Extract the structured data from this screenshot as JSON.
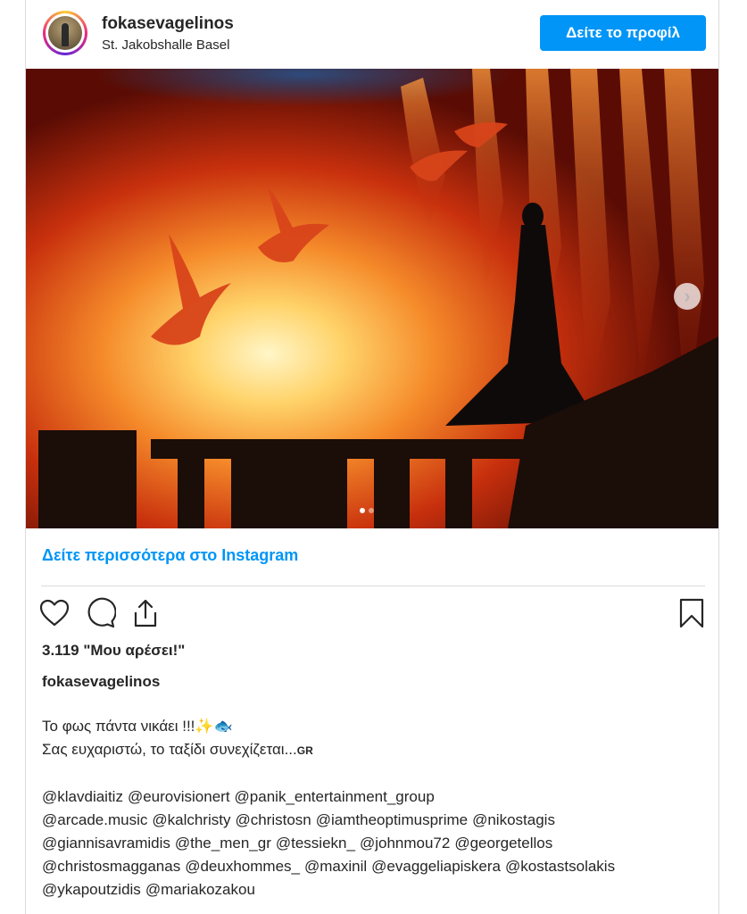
{
  "header": {
    "username": "fokasevagelinos",
    "location": "St. Jakobshalle Basel",
    "view_profile_label": "Δείτε το προφίλ"
  },
  "media": {
    "carousel_count": 2,
    "carousel_active": 1,
    "next_icon": "chevron-right-icon"
  },
  "more_link": "Δείτε περισσότερα στο Instagram",
  "actions": {
    "like_icon": "heart-icon",
    "comment_icon": "comment-icon",
    "share_icon": "share-icon",
    "save_icon": "bookmark-icon"
  },
  "likes_text": "3.119 \"Μου αρέσει!\"",
  "caption": {
    "username": "fokasevagelinos",
    "line1": "Το φως πάντα νικάει !!!",
    "line1_emoji": "✨🐟",
    "line2": "Σας ευχαριστώ, το ταξίδι συνεχίζεται...",
    "line2_suffix": "GR"
  },
  "tags": [
    "@klavdiaitiz",
    "@eurovisionert",
    "@panik_entertainment_group",
    "@arcade.music",
    "@kalchristy",
    "@christosn",
    "@iamtheoptimusprime",
    "@nikostagis",
    "@giannisavramidis",
    "@the_men_gr",
    "@tessiekn_",
    "@johnmou72",
    "@georgetellos",
    "@christosmagganas",
    "@deuxhommes_",
    "@maxinil",
    "@evaggeliapiskera",
    "@kostastsolakis",
    "@ykapoutzidis",
    "@mariakozakou"
  ],
  "colors": {
    "accent": "#0095f6",
    "text": "#262626",
    "border": "#dbdbdb"
  }
}
